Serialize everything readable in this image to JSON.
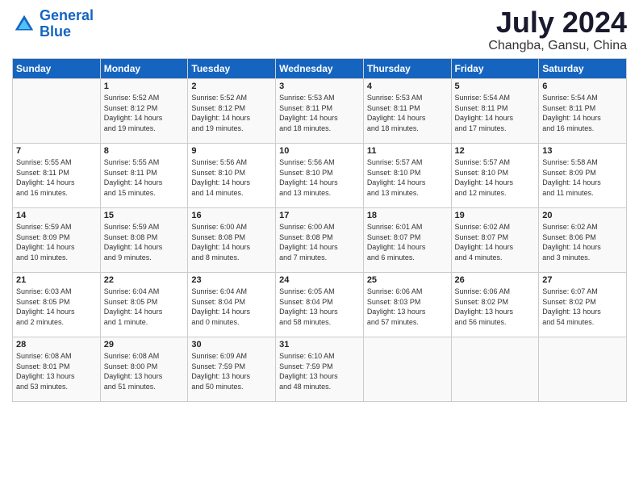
{
  "logo": {
    "line1": "General",
    "line2": "Blue"
  },
  "title": "July 2024",
  "location": "Changba, Gansu, China",
  "days_of_week": [
    "Sunday",
    "Monday",
    "Tuesday",
    "Wednesday",
    "Thursday",
    "Friday",
    "Saturday"
  ],
  "weeks": [
    [
      {
        "day": "",
        "info": ""
      },
      {
        "day": "1",
        "info": "Sunrise: 5:52 AM\nSunset: 8:12 PM\nDaylight: 14 hours\nand 19 minutes."
      },
      {
        "day": "2",
        "info": "Sunrise: 5:52 AM\nSunset: 8:12 PM\nDaylight: 14 hours\nand 19 minutes."
      },
      {
        "day": "3",
        "info": "Sunrise: 5:53 AM\nSunset: 8:11 PM\nDaylight: 14 hours\nand 18 minutes."
      },
      {
        "day": "4",
        "info": "Sunrise: 5:53 AM\nSunset: 8:11 PM\nDaylight: 14 hours\nand 18 minutes."
      },
      {
        "day": "5",
        "info": "Sunrise: 5:54 AM\nSunset: 8:11 PM\nDaylight: 14 hours\nand 17 minutes."
      },
      {
        "day": "6",
        "info": "Sunrise: 5:54 AM\nSunset: 8:11 PM\nDaylight: 14 hours\nand 16 minutes."
      }
    ],
    [
      {
        "day": "7",
        "info": "Sunrise: 5:55 AM\nSunset: 8:11 PM\nDaylight: 14 hours\nand 16 minutes."
      },
      {
        "day": "8",
        "info": "Sunrise: 5:55 AM\nSunset: 8:11 PM\nDaylight: 14 hours\nand 15 minutes."
      },
      {
        "day": "9",
        "info": "Sunrise: 5:56 AM\nSunset: 8:10 PM\nDaylight: 14 hours\nand 14 minutes."
      },
      {
        "day": "10",
        "info": "Sunrise: 5:56 AM\nSunset: 8:10 PM\nDaylight: 14 hours\nand 13 minutes."
      },
      {
        "day": "11",
        "info": "Sunrise: 5:57 AM\nSunset: 8:10 PM\nDaylight: 14 hours\nand 13 minutes."
      },
      {
        "day": "12",
        "info": "Sunrise: 5:57 AM\nSunset: 8:10 PM\nDaylight: 14 hours\nand 12 minutes."
      },
      {
        "day": "13",
        "info": "Sunrise: 5:58 AM\nSunset: 8:09 PM\nDaylight: 14 hours\nand 11 minutes."
      }
    ],
    [
      {
        "day": "14",
        "info": "Sunrise: 5:59 AM\nSunset: 8:09 PM\nDaylight: 14 hours\nand 10 minutes."
      },
      {
        "day": "15",
        "info": "Sunrise: 5:59 AM\nSunset: 8:08 PM\nDaylight: 14 hours\nand 9 minutes."
      },
      {
        "day": "16",
        "info": "Sunrise: 6:00 AM\nSunset: 8:08 PM\nDaylight: 14 hours\nand 8 minutes."
      },
      {
        "day": "17",
        "info": "Sunrise: 6:00 AM\nSunset: 8:08 PM\nDaylight: 14 hours\nand 7 minutes."
      },
      {
        "day": "18",
        "info": "Sunrise: 6:01 AM\nSunset: 8:07 PM\nDaylight: 14 hours\nand 6 minutes."
      },
      {
        "day": "19",
        "info": "Sunrise: 6:02 AM\nSunset: 8:07 PM\nDaylight: 14 hours\nand 4 minutes."
      },
      {
        "day": "20",
        "info": "Sunrise: 6:02 AM\nSunset: 8:06 PM\nDaylight: 14 hours\nand 3 minutes."
      }
    ],
    [
      {
        "day": "21",
        "info": "Sunrise: 6:03 AM\nSunset: 8:05 PM\nDaylight: 14 hours\nand 2 minutes."
      },
      {
        "day": "22",
        "info": "Sunrise: 6:04 AM\nSunset: 8:05 PM\nDaylight: 14 hours\nand 1 minute."
      },
      {
        "day": "23",
        "info": "Sunrise: 6:04 AM\nSunset: 8:04 PM\nDaylight: 14 hours\nand 0 minutes."
      },
      {
        "day": "24",
        "info": "Sunrise: 6:05 AM\nSunset: 8:04 PM\nDaylight: 13 hours\nand 58 minutes."
      },
      {
        "day": "25",
        "info": "Sunrise: 6:06 AM\nSunset: 8:03 PM\nDaylight: 13 hours\nand 57 minutes."
      },
      {
        "day": "26",
        "info": "Sunrise: 6:06 AM\nSunset: 8:02 PM\nDaylight: 13 hours\nand 56 minutes."
      },
      {
        "day": "27",
        "info": "Sunrise: 6:07 AM\nSunset: 8:02 PM\nDaylight: 13 hours\nand 54 minutes."
      }
    ],
    [
      {
        "day": "28",
        "info": "Sunrise: 6:08 AM\nSunset: 8:01 PM\nDaylight: 13 hours\nand 53 minutes."
      },
      {
        "day": "29",
        "info": "Sunrise: 6:08 AM\nSunset: 8:00 PM\nDaylight: 13 hours\nand 51 minutes."
      },
      {
        "day": "30",
        "info": "Sunrise: 6:09 AM\nSunset: 7:59 PM\nDaylight: 13 hours\nand 50 minutes."
      },
      {
        "day": "31",
        "info": "Sunrise: 6:10 AM\nSunset: 7:59 PM\nDaylight: 13 hours\nand 48 minutes."
      },
      {
        "day": "",
        "info": ""
      },
      {
        "day": "",
        "info": ""
      },
      {
        "day": "",
        "info": ""
      }
    ]
  ]
}
